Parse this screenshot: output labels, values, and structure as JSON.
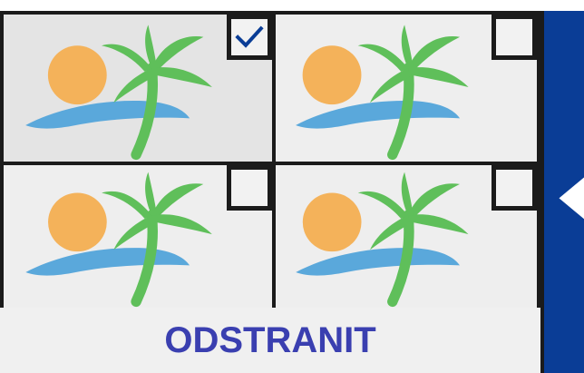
{
  "photos": [
    {
      "id": "photo-1",
      "selected": true
    },
    {
      "id": "photo-2",
      "selected": false
    },
    {
      "id": "photo-3",
      "selected": false
    },
    {
      "id": "photo-4",
      "selected": false
    }
  ],
  "remove_button": {
    "label": "ODSTRANIT"
  },
  "icons": {
    "thumbnail": "beach-palm-sun-icon",
    "checkbox_checked": "checkmark-icon",
    "side_arrow": "chevron-left-icon"
  },
  "colors": {
    "accent": "#0a3d96",
    "label": "#3a3fb0",
    "check": "#0a3d96",
    "palm": "#5fbf5a",
    "sun": "#f4b25a",
    "water": "#5aa8db",
    "tile_border": "#1b1b1b"
  }
}
